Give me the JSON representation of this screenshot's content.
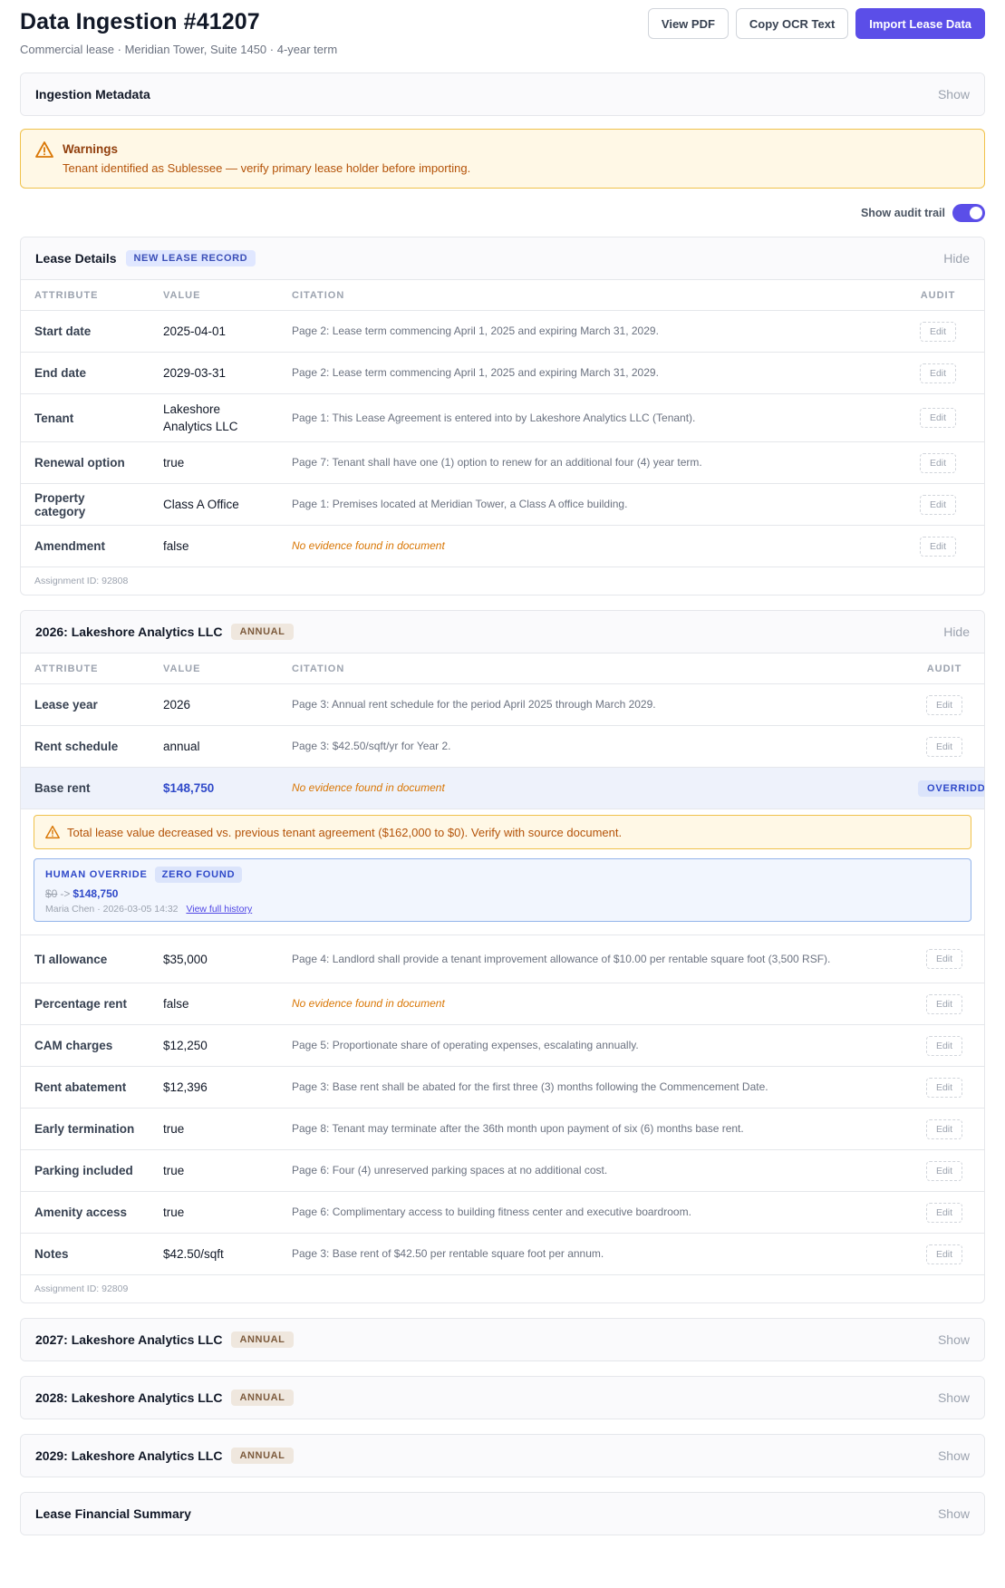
{
  "header": {
    "title": "Data Ingestion #41207",
    "subtitle": "Commercial lease · Meridian Tower, Suite 1450 · 4-year term",
    "buttons": {
      "view_pdf": "View PDF",
      "copy_ocr": "Copy OCR Text",
      "import": "Import Lease Data"
    }
  },
  "metadata": {
    "title": "Ingestion Metadata",
    "toggle": "Show"
  },
  "warnings": {
    "title": "Warnings",
    "text": "Tenant identified as Sublessee — verify primary lease holder before importing."
  },
  "audit_toggle": {
    "label": "Show audit trail",
    "on": true
  },
  "columns": {
    "attribute": "ATTRIBUTE",
    "value": "VALUE",
    "citation": "CITATION",
    "audit": "AUDIT"
  },
  "edit_label": "Edit",
  "lease_details": {
    "title": "Lease Details",
    "badge": "NEW LEASE RECORD",
    "toggle": "Hide",
    "rows": [
      {
        "attr": "Start date",
        "value": "2025-04-01",
        "citation": "Page 2: Lease term commencing April 1, 2025 and expiring March 31, 2029."
      },
      {
        "attr": "End date",
        "value": "2029-03-31",
        "citation": "Page 2: Lease term commencing April 1, 2025 and expiring March 31, 2029."
      },
      {
        "attr": "Tenant",
        "value": "Lakeshore Analytics LLC",
        "citation": "Page 1: This Lease Agreement is entered into by Lakeshore Analytics LLC (Tenant)."
      },
      {
        "attr": "Renewal option",
        "value": "true",
        "citation": "Page 7: Tenant shall have one (1) option to renew for an additional four (4) year term."
      },
      {
        "attr": "Property category",
        "value": "Class A Office",
        "citation": "Page 1: Premises located at Meridian Tower, a Class A office building."
      },
      {
        "attr": "Amendment",
        "value": "false",
        "citation": "No evidence found in document"
      }
    ],
    "footer": "Assignment ID: 92808"
  },
  "year_2026": {
    "title": "2026: Lakeshore Analytics LLC",
    "badge": "ANNUAL",
    "toggle": "Hide",
    "rows_top": [
      {
        "attr": "Lease year",
        "value": "2026",
        "citation": "Page 3: Annual rent schedule for the period April 2025 through March 2029."
      },
      {
        "attr": "Rent schedule",
        "value": "annual",
        "citation": "Page 3: $42.50/sqft/yr for Year 2."
      }
    ],
    "override_row": {
      "attr": "Base rent",
      "value": "$148,750",
      "citation": "No evidence found in document",
      "badge": "OVERRIDDEN"
    },
    "inner_warning": "Total lease value decreased vs. previous tenant agreement ($162,000 to $0). Verify with source document.",
    "override": {
      "label": "HUMAN OVERRIDE",
      "badge": "ZERO FOUND",
      "old": "$0",
      "arrow": "->",
      "new": "$148,750",
      "meta": "Maria Chen · 2026-03-05 14:32",
      "history_link": "View full history"
    },
    "rows_bottom": [
      {
        "attr": "TI allowance",
        "value": "$35,000",
        "citation": "Page 4: Landlord shall provide a tenant improvement allowance of $10.00 per rentable square foot (3,500 RSF)."
      },
      {
        "attr": "Percentage rent",
        "value": "false",
        "citation": "No evidence found in document"
      },
      {
        "attr": "CAM charges",
        "value": "$12,250",
        "citation": "Page 5: Proportionate share of operating expenses, escalating annually."
      },
      {
        "attr": "Rent abatement",
        "value": "$12,396",
        "citation": "Page 3: Base rent shall be abated for the first three (3) months following the Commencement Date."
      },
      {
        "attr": "Early termination",
        "value": "true",
        "citation": "Page 8: Tenant may terminate after the 36th month upon payment of six (6) months base rent."
      },
      {
        "attr": "Parking included",
        "value": "true",
        "citation": "Page 6: Four (4) unreserved parking spaces at no additional cost."
      },
      {
        "attr": "Amenity access",
        "value": "true",
        "citation": "Page 6: Complimentary access to building fitness center and executive boardroom."
      },
      {
        "attr": "Notes",
        "value": "$42.50/sqft",
        "citation": "Page 3: Base rent of $42.50 per rentable square foot per annum."
      }
    ],
    "footer": "Assignment ID: 92809"
  },
  "collapsed_sections": [
    {
      "title": "2027: Lakeshore Analytics LLC",
      "badge": "ANNUAL",
      "toggle": "Show"
    },
    {
      "title": "2028: Lakeshore Analytics LLC",
      "badge": "ANNUAL",
      "toggle": "Show"
    },
    {
      "title": "2029: Lakeshore Analytics LLC",
      "badge": "ANNUAL",
      "toggle": "Show"
    }
  ],
  "financial_summary": {
    "title": "Lease Financial Summary",
    "toggle": "Show"
  },
  "colors": {
    "accent": "#5b4ee8",
    "warning_border": "#f0c24b",
    "override_blue": "#2f49c9"
  },
  "icons": {
    "warning": "warning-triangle-icon"
  }
}
